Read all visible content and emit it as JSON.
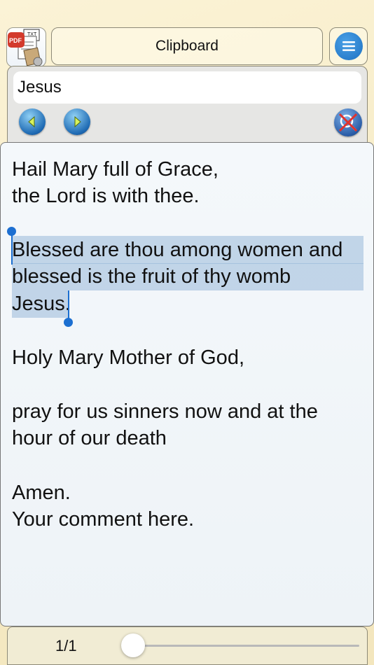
{
  "header": {
    "title": "Clipboard",
    "app_icon": "pdf-txt-app-icon",
    "app_icon_pdf_label": "PDF",
    "app_icon_txt_label": "TXT",
    "menu_icon": "hamburger-menu-icon",
    "accent_color": "#1d71c2"
  },
  "search": {
    "query": "Jesus",
    "prev_icon": "left-arrow-icon",
    "next_icon": "right-arrow-icon",
    "clear_icon": "clear-search-icon"
  },
  "document": {
    "lines": [
      "Hail Mary full of Grace,",
      "the Lord is with thee.",
      "Blessed are thou among women and",
      "blessed is the fruit of thy womb",
      "Jesus",
      ".",
      "Holy Mary Mother of God,",
      "pray for us sinners now and at the",
      "hour of our death",
      "Amen.",
      "Your comment here."
    ],
    "selection_color": "#84aad2"
  },
  "footer": {
    "page_indicator": "1/1",
    "slider_fraction": 0
  }
}
